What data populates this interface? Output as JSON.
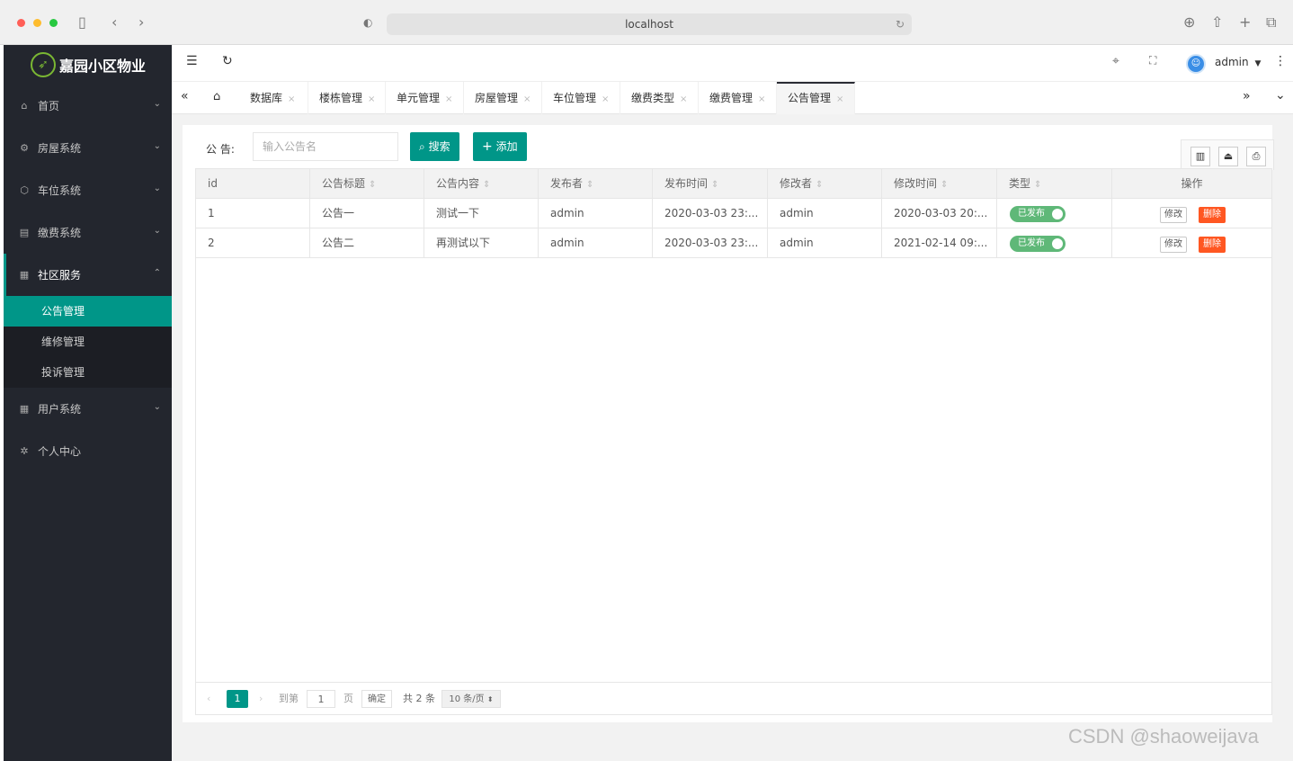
{
  "browser": {
    "url": "localhost",
    "traffic_colors": [
      "#ff5f57",
      "#febc2e",
      "#28c840"
    ]
  },
  "app": {
    "name": "嘉园小区物业",
    "accent": "#009688"
  },
  "sidebar": {
    "items": [
      {
        "label": "首页",
        "icon": "home-icon"
      },
      {
        "label": "房屋系统",
        "icon": "gear-icon"
      },
      {
        "label": "车位系统",
        "icon": "cube-icon"
      },
      {
        "label": "缴费系统",
        "icon": "bill-icon"
      },
      {
        "label": "社区服务",
        "icon": "apps-icon",
        "open": true
      },
      {
        "label": "用户系统",
        "icon": "apps-icon"
      },
      {
        "label": "个人中心",
        "icon": "settings-icon"
      }
    ],
    "submenu": [
      "公告管理",
      "维修管理",
      "投诉管理"
    ]
  },
  "topbar": {
    "user": "admin"
  },
  "tabs": [
    {
      "label": "数据库"
    },
    {
      "label": "楼栋管理"
    },
    {
      "label": "单元管理"
    },
    {
      "label": "房屋管理"
    },
    {
      "label": "车位管理"
    },
    {
      "label": "缴费类型"
    },
    {
      "label": "缴费管理"
    },
    {
      "label": "公告管理",
      "active": true
    }
  ],
  "search": {
    "label": "公 告:",
    "placeholder": "输入公告名",
    "search_button": "搜索",
    "add_button": "添加"
  },
  "table": {
    "columns": [
      "id",
      "公告标题",
      "公告内容",
      "发布者",
      "发布时间",
      "修改者",
      "修改时间",
      "类型",
      "操作"
    ],
    "rows": [
      {
        "id": "1",
        "title": "公告一",
        "content": "测试一下",
        "publisher": "admin",
        "publish_time": "2020-03-03 23:...",
        "modifier": "admin",
        "modify_time": "2020-03-03 20:...",
        "type": "已发布",
        "edit": "修改",
        "delete": "删除"
      },
      {
        "id": "2",
        "title": "公告二",
        "content": "再测试以下",
        "publisher": "admin",
        "publish_time": "2020-03-03 23:...",
        "modifier": "admin",
        "modify_time": "2021-02-14 09:...",
        "type": "已发布",
        "edit": "修改",
        "delete": "删除"
      }
    ]
  },
  "pagination": {
    "current_page": "1",
    "goto_label": "到第",
    "goto_value": "1",
    "page_unit": "页",
    "confirm": "确定",
    "total": "共 2 条",
    "page_size": "10 条/页"
  },
  "watermark": "CSDN @shaoweijava"
}
